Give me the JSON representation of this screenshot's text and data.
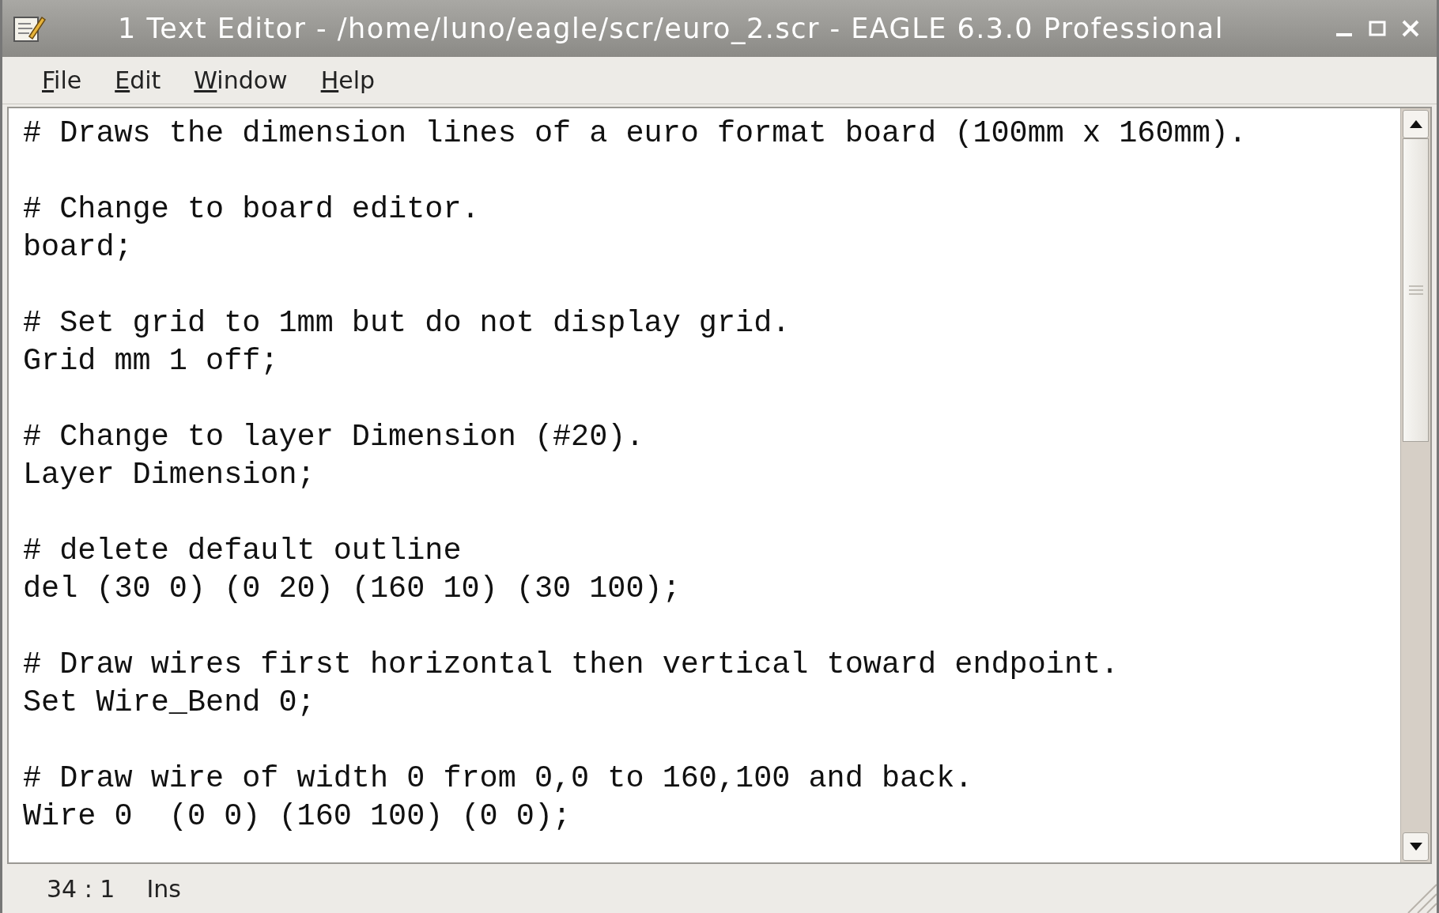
{
  "window": {
    "title": "1 Text Editor - /home/luno/eagle/scr/euro_2.scr - EAGLE 6.3.0 Professional"
  },
  "menu": [
    "File",
    "Edit",
    "Window",
    "Help"
  ],
  "editor": {
    "blocks": [
      [
        "# Draws the dimension lines of a euro format board (100mm x 160mm)."
      ],
      [
        "# Change to board editor.",
        "board;"
      ],
      [
        "# Set grid to 1mm but do not display grid.",
        "Grid mm 1 off;"
      ],
      [
        "# Change to layer Dimension (#20).",
        "Layer Dimension;"
      ],
      [
        "# delete default outline",
        "del (30 0) (0 20) (160 10) (30 100);"
      ],
      [
        "# Draw wires first horizontal then vertical toward endpoint.",
        "Set Wire_Bend 0;"
      ],
      [
        "# Draw wire of width 0 from 0,0 to 160,100 and back.",
        "Wire 0  (0 0) (160 100) (0 0);"
      ]
    ]
  },
  "status_bar": {
    "position": "34 : 1",
    "mode": "Ins"
  }
}
